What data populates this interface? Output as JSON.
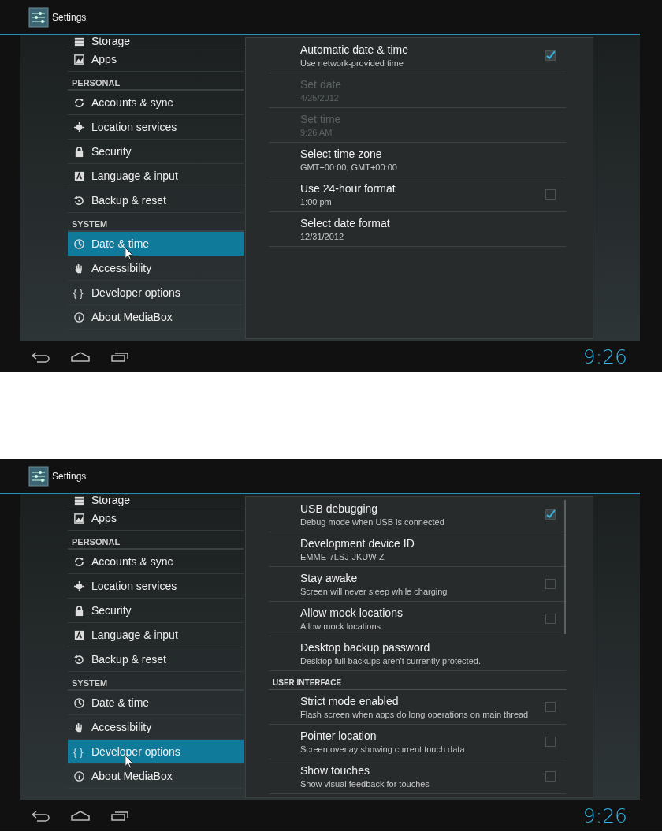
{
  "screens": [
    {
      "title": "Settings",
      "sidebar": [
        {
          "kind": "item",
          "label": "Storage",
          "selected": false
        },
        {
          "kind": "item",
          "label": "Apps",
          "selected": false
        },
        {
          "kind": "header",
          "label": "PERSONAL"
        },
        {
          "kind": "item",
          "label": "Accounts & sync",
          "selected": false
        },
        {
          "kind": "item",
          "label": "Location services",
          "selected": false
        },
        {
          "kind": "item",
          "label": "Security",
          "selected": false
        },
        {
          "kind": "item",
          "label": "Language & input",
          "selected": false
        },
        {
          "kind": "item",
          "label": "Backup & reset",
          "selected": false
        },
        {
          "kind": "header",
          "label": "SYSTEM"
        },
        {
          "kind": "item",
          "label": "Date & time",
          "selected": true
        },
        {
          "kind": "item",
          "label": "Accessibility",
          "selected": false
        },
        {
          "kind": "item",
          "label": "Developer options",
          "selected": false,
          "glyph": "{ }"
        },
        {
          "kind": "item",
          "label": "About MediaBox",
          "selected": false
        }
      ],
      "scrollbar": false,
      "prefs": [
        {
          "kind": "checkbox",
          "title": "Automatic date & time",
          "summary": "Use network-provided time",
          "disabled": false,
          "checked": true
        },
        {
          "kind": "plain",
          "title": "Set date",
          "summary": "4/25/2012",
          "disabled": true
        },
        {
          "kind": "plain",
          "title": "Set time",
          "summary": "9:26 AM",
          "disabled": true
        },
        {
          "kind": "plain",
          "title": "Select time zone",
          "summary": "GMT+00:00, GMT+00:00",
          "disabled": false
        },
        {
          "kind": "checkbox",
          "title": "Use 24-hour format",
          "summary": "1:00 pm",
          "disabled": false,
          "checked": false
        },
        {
          "kind": "plain",
          "title": "Select date format",
          "summary": "12/31/2012",
          "disabled": false
        }
      ],
      "clock": "9:26"
    },
    {
      "title": "Settings",
      "sidebar": [
        {
          "kind": "item",
          "label": "Storage",
          "selected": false
        },
        {
          "kind": "item",
          "label": "Apps",
          "selected": false
        },
        {
          "kind": "header",
          "label": "PERSONAL"
        },
        {
          "kind": "item",
          "label": "Accounts & sync",
          "selected": false
        },
        {
          "kind": "item",
          "label": "Location services",
          "selected": false
        },
        {
          "kind": "item",
          "label": "Security",
          "selected": false
        },
        {
          "kind": "item",
          "label": "Language & input",
          "selected": false
        },
        {
          "kind": "item",
          "label": "Backup & reset",
          "selected": false
        },
        {
          "kind": "header",
          "label": "SYSTEM"
        },
        {
          "kind": "item",
          "label": "Date & time",
          "selected": false
        },
        {
          "kind": "item",
          "label": "Accessibility",
          "selected": false
        },
        {
          "kind": "item",
          "label": "Developer options",
          "selected": true,
          "glyph": "{ }"
        },
        {
          "kind": "item",
          "label": "About MediaBox",
          "selected": false
        }
      ],
      "scrollbar": true,
      "prefs": [
        {
          "kind": "checkbox",
          "title": "USB debugging",
          "summary": "Debug mode when USB is connected",
          "disabled": false,
          "checked": true
        },
        {
          "kind": "plain",
          "title": "Development device ID",
          "summary": "EMME-7LSJ-JKUW-Z",
          "disabled": false
        },
        {
          "kind": "checkbox",
          "title": "Stay awake",
          "summary": "Screen will never sleep while charging",
          "disabled": false,
          "checked": false
        },
        {
          "kind": "checkbox",
          "title": "Allow mock locations",
          "summary": "Allow mock locations",
          "disabled": false,
          "checked": false
        },
        {
          "kind": "plain",
          "title": "Desktop backup password",
          "summary": "Desktop full backups aren't currently protected.",
          "disabled": false
        },
        {
          "kind": "category",
          "label": "USER INTERFACE"
        },
        {
          "kind": "checkbox",
          "title": "Strict mode enabled",
          "summary": "Flash screen when apps do long operations on main thread",
          "disabled": false,
          "checked": false
        },
        {
          "kind": "checkbox",
          "title": "Pointer location",
          "summary": "Screen overlay showing current touch data",
          "disabled": false,
          "checked": false
        },
        {
          "kind": "checkbox",
          "title": "Show touches",
          "summary": "Show visual feedback for touches",
          "disabled": false,
          "checked": false
        }
      ],
      "clock": "9:26"
    }
  ]
}
